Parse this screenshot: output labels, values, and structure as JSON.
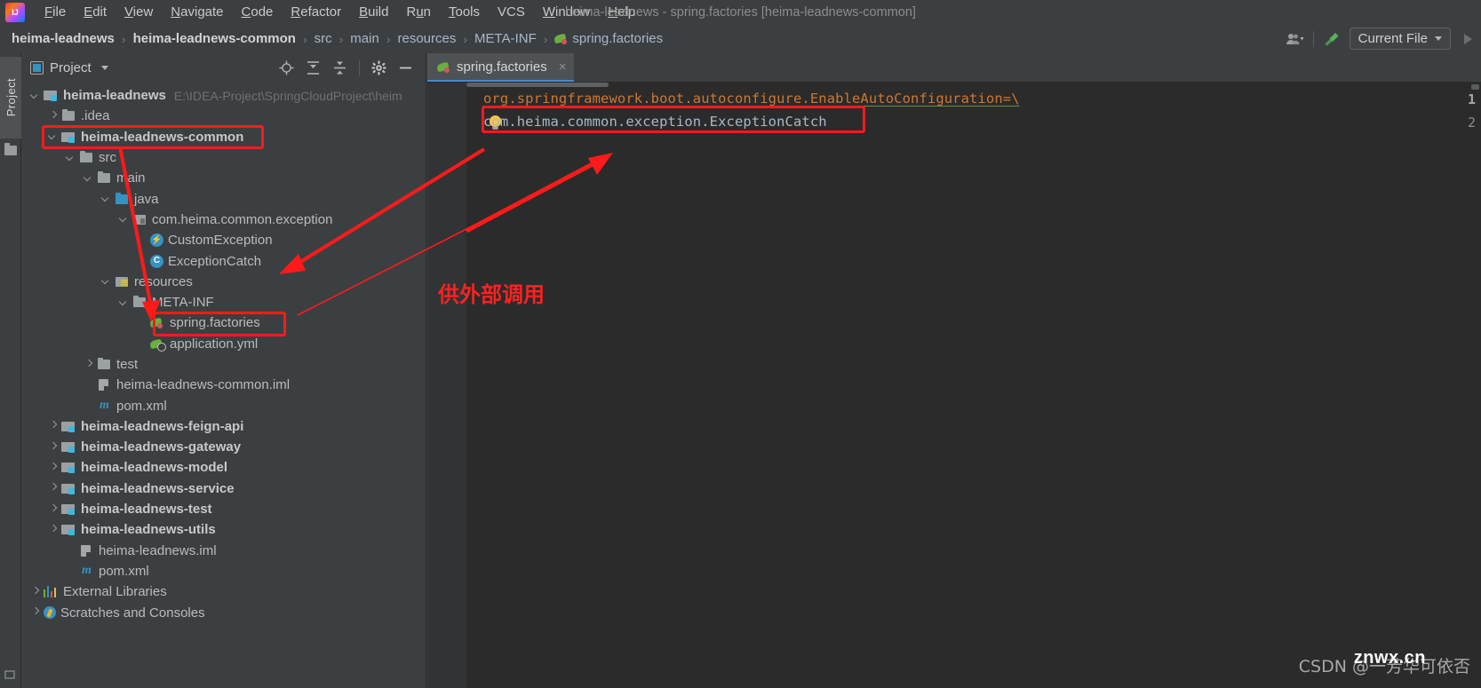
{
  "window": {
    "title": "heima-leadnews - spring.factories [heima-leadnews-common]",
    "logo_text": "IJ"
  },
  "menu": {
    "items": [
      {
        "label": "File",
        "mnemonic": "F"
      },
      {
        "label": "Edit",
        "mnemonic": "E"
      },
      {
        "label": "View",
        "mnemonic": "V"
      },
      {
        "label": "Navigate",
        "mnemonic": "N"
      },
      {
        "label": "Code",
        "mnemonic": "C"
      },
      {
        "label": "Refactor",
        "mnemonic": "R"
      },
      {
        "label": "Build",
        "mnemonic": "B"
      },
      {
        "label": "Run",
        "mnemonic": "u"
      },
      {
        "label": "Tools",
        "mnemonic": "T"
      },
      {
        "label": "VCS",
        "mnemonic": ""
      },
      {
        "label": "Window",
        "mnemonic": "W"
      },
      {
        "label": "Help",
        "mnemonic": "H"
      }
    ]
  },
  "navbar": {
    "breadcrumb": [
      {
        "label": "heima-leadnews",
        "bold": true,
        "icon": ""
      },
      {
        "label": "heima-leadnews-common",
        "bold": true,
        "icon": ""
      },
      {
        "label": "src",
        "bold": false,
        "icon": ""
      },
      {
        "label": "main",
        "bold": false,
        "icon": ""
      },
      {
        "label": "resources",
        "bold": false,
        "icon": ""
      },
      {
        "label": "META-INF",
        "bold": false,
        "icon": ""
      },
      {
        "label": "spring.factories",
        "bold": false,
        "icon": "spring-icon"
      }
    ],
    "separator": "›",
    "run_config": "Current File",
    "icons": [
      "user-avatar-icon",
      "hammer-build-icon",
      "run-play-icon"
    ]
  },
  "toolstrip": {
    "project_tab": "Project"
  },
  "project_panel": {
    "title": "Project",
    "header_icons": [
      "locate-target-icon",
      "expand-all-icon",
      "collapse-all-icon",
      "settings-gear-icon",
      "hide-minimize-icon"
    ],
    "tree": [
      {
        "depth": 0,
        "arrow": "down",
        "icon": "module",
        "label": "heima-leadnews",
        "bold": true,
        "hint": "E:\\IDEA-Project\\SpringCloudProject\\heim"
      },
      {
        "depth": 1,
        "arrow": "right",
        "icon": "folder",
        "label": ".idea",
        "bold": false,
        "hint": ""
      },
      {
        "depth": 1,
        "arrow": "down",
        "icon": "module",
        "label": "heima-leadnews-common",
        "bold": true,
        "hint": "",
        "highlight": true
      },
      {
        "depth": 2,
        "arrow": "down",
        "icon": "folder",
        "label": "src",
        "bold": false,
        "hint": ""
      },
      {
        "depth": 3,
        "arrow": "down",
        "icon": "folder",
        "label": "main",
        "bold": false,
        "hint": ""
      },
      {
        "depth": 4,
        "arrow": "down",
        "icon": "src",
        "label": "java",
        "bold": false,
        "hint": ""
      },
      {
        "depth": 5,
        "arrow": "down",
        "icon": "pkg",
        "label": "com.heima.common.exception",
        "bold": false,
        "hint": ""
      },
      {
        "depth": 6,
        "arrow": "none",
        "icon": "class-ex",
        "label": "CustomException",
        "bold": false,
        "hint": ""
      },
      {
        "depth": 6,
        "arrow": "none",
        "icon": "class-c",
        "label": "ExceptionCatch",
        "bold": false,
        "hint": ""
      },
      {
        "depth": 4,
        "arrow": "down",
        "icon": "res",
        "label": "resources",
        "bold": false,
        "hint": ""
      },
      {
        "depth": 5,
        "arrow": "down",
        "icon": "folder",
        "label": "META-INF",
        "bold": false,
        "hint": ""
      },
      {
        "depth": 6,
        "arrow": "none",
        "icon": "spring",
        "label": "spring.factories",
        "bold": false,
        "hint": "",
        "highlight": true
      },
      {
        "depth": 6,
        "arrow": "none",
        "icon": "yml",
        "label": "application.yml",
        "bold": false,
        "hint": ""
      },
      {
        "depth": 3,
        "arrow": "right",
        "icon": "folder",
        "label": "test",
        "bold": false,
        "hint": ""
      },
      {
        "depth": 3,
        "arrow": "none",
        "icon": "iml",
        "label": "heima-leadnews-common.iml",
        "bold": false,
        "hint": ""
      },
      {
        "depth": 3,
        "arrow": "none",
        "icon": "maven",
        "label": "pom.xml",
        "bold": false,
        "hint": ""
      },
      {
        "depth": 1,
        "arrow": "right",
        "icon": "module",
        "label": "heima-leadnews-feign-api",
        "bold": true,
        "hint": ""
      },
      {
        "depth": 1,
        "arrow": "right",
        "icon": "module",
        "label": "heima-leadnews-gateway",
        "bold": true,
        "hint": ""
      },
      {
        "depth": 1,
        "arrow": "right",
        "icon": "module",
        "label": "heima-leadnews-model",
        "bold": true,
        "hint": ""
      },
      {
        "depth": 1,
        "arrow": "right",
        "icon": "module",
        "label": "heima-leadnews-service",
        "bold": true,
        "hint": ""
      },
      {
        "depth": 1,
        "arrow": "right",
        "icon": "module",
        "label": "heima-leadnews-test",
        "bold": true,
        "hint": ""
      },
      {
        "depth": 1,
        "arrow": "right",
        "icon": "module",
        "label": "heima-leadnews-utils",
        "bold": true,
        "hint": ""
      },
      {
        "depth": 2,
        "arrow": "none",
        "icon": "iml",
        "label": "heima-leadnews.iml",
        "bold": false,
        "hint": ""
      },
      {
        "depth": 2,
        "arrow": "none",
        "icon": "maven",
        "label": "pom.xml",
        "bold": false,
        "hint": ""
      },
      {
        "depth": 0,
        "arrow": "right",
        "icon": "libs",
        "label": "External Libraries",
        "bold": false,
        "hint": ""
      },
      {
        "depth": 0,
        "arrow": "right",
        "icon": "scratch",
        "label": "Scratches and Consoles",
        "bold": false,
        "hint": ""
      }
    ]
  },
  "editor": {
    "tab": {
      "label": "spring.factories",
      "close": "×",
      "icon": "spring-icon"
    },
    "lines": [
      {
        "number": "1",
        "text": "org.springframework.boot.autoconfigure.EnableAutoConfiguration=\\"
      },
      {
        "number": "2",
        "text": "com.heima.common.exception.ExceptionCatch"
      }
    ],
    "line1_key": "org.springframework.boot.autoconfigure.EnableAutoConfiguration",
    "line1_eq": "=\\",
    "line2_value": "com.heima.common.exception.ExceptionCatch"
  },
  "annotations": {
    "chinese_note": "供外部调用",
    "highlight_color": "#ff1a1a"
  },
  "watermark": {
    "text": "CSDN @一芳华可依否",
    "brand": "znwx.cn"
  }
}
